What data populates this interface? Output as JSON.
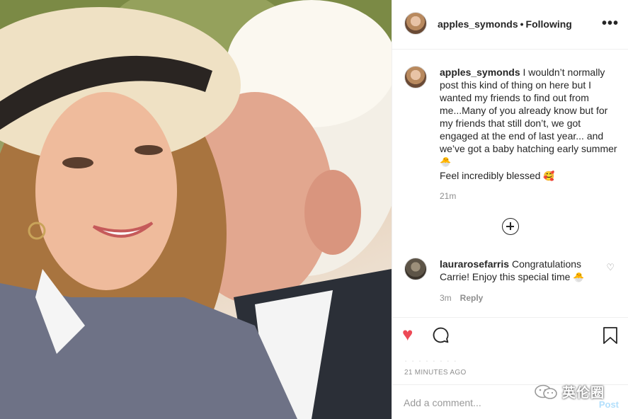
{
  "post": {
    "username": "apples_symonds",
    "separator": "•",
    "follow_state": "Following",
    "more_label": "•••",
    "caption": {
      "username": "apples_symonds",
      "text_line_1": " I wouldn’t normally post this kind of thing on here but I wanted my friends to find out from me...Many of you already know but for my friends that still don’t, we got engaged at the end of last year... and we’ve got a baby hatching early summer",
      "hatching_emoji": "🐣",
      "text_line_2": "Feel incredibly blessed ",
      "blessed_emoji": "🥰",
      "time": "21m"
    },
    "comments": [
      {
        "username": "laurarosefarris",
        "text": " Congratulations Carrie! Enjoy this special time ",
        "emoji": "🐣",
        "time": "3m",
        "reply_label": "Reply"
      }
    ],
    "likes_blurred": "· · · · · ·  · ·",
    "time_ago": "21 MINUTES AGO",
    "add_comment_placeholder": "Add a comment...",
    "post_label": "Post"
  },
  "watermark": {
    "text": "英伦圈"
  },
  "icons": {
    "like": "heart-filled-icon",
    "comment": "comment-bubble-icon",
    "save": "bookmark-icon",
    "load_more": "plus-circle-icon",
    "comment_like": "heart-outline-icon",
    "watermark": "wechat-icon"
  },
  "colors": {
    "like_red": "#ed4956",
    "post_button_disabled": "#b2dffc",
    "muted_text": "#8e8e8e",
    "text": "#262626"
  }
}
